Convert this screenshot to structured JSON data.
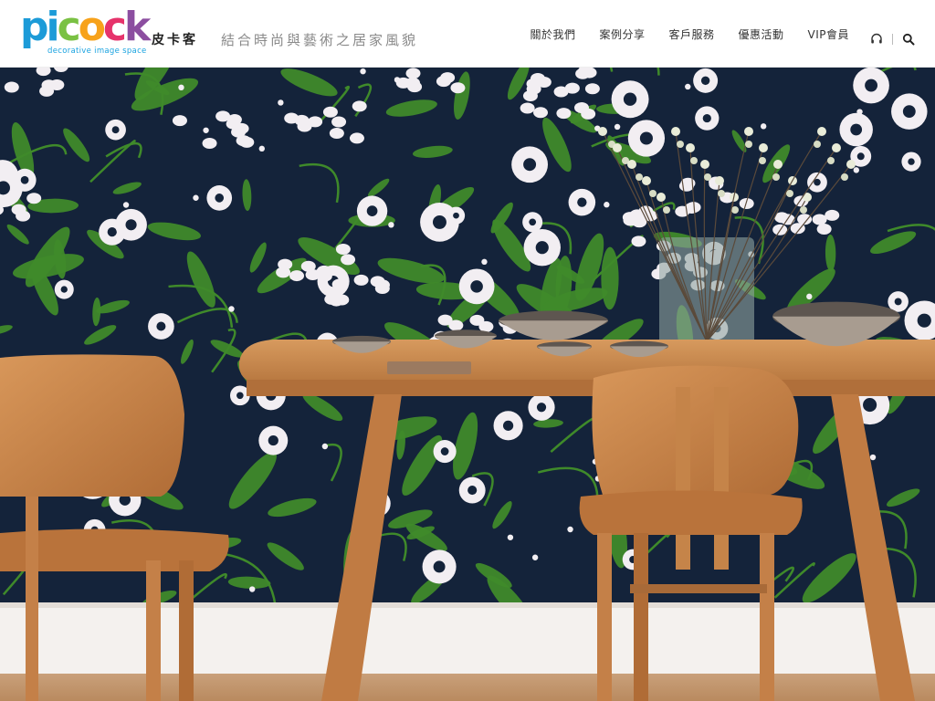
{
  "brand": {
    "logo_text": [
      "p",
      "i",
      "c",
      "o",
      "c",
      "k"
    ],
    "logo_colors": [
      "#1c9bd8",
      "#1c9bd8",
      "#7ac143",
      "#f7a21b",
      "#e6336b",
      "#8c4ea0"
    ],
    "logo_tagline": "decorative image space",
    "name_cn": "皮卡客",
    "slogan": "結合時尚與藝術之居家風貌"
  },
  "nav": {
    "items": [
      "關於我們",
      "案例分享",
      "客戶服務",
      "優惠活動",
      "VIP會員"
    ]
  },
  "tools": {
    "headset_icon": "headset-icon",
    "search_icon": "search-icon"
  },
  "hero": {
    "wall_color": "#14233a",
    "leaf_color": "#3f8a2a",
    "flower_color": "#f2eef2",
    "wood_color": "#c8834a"
  }
}
